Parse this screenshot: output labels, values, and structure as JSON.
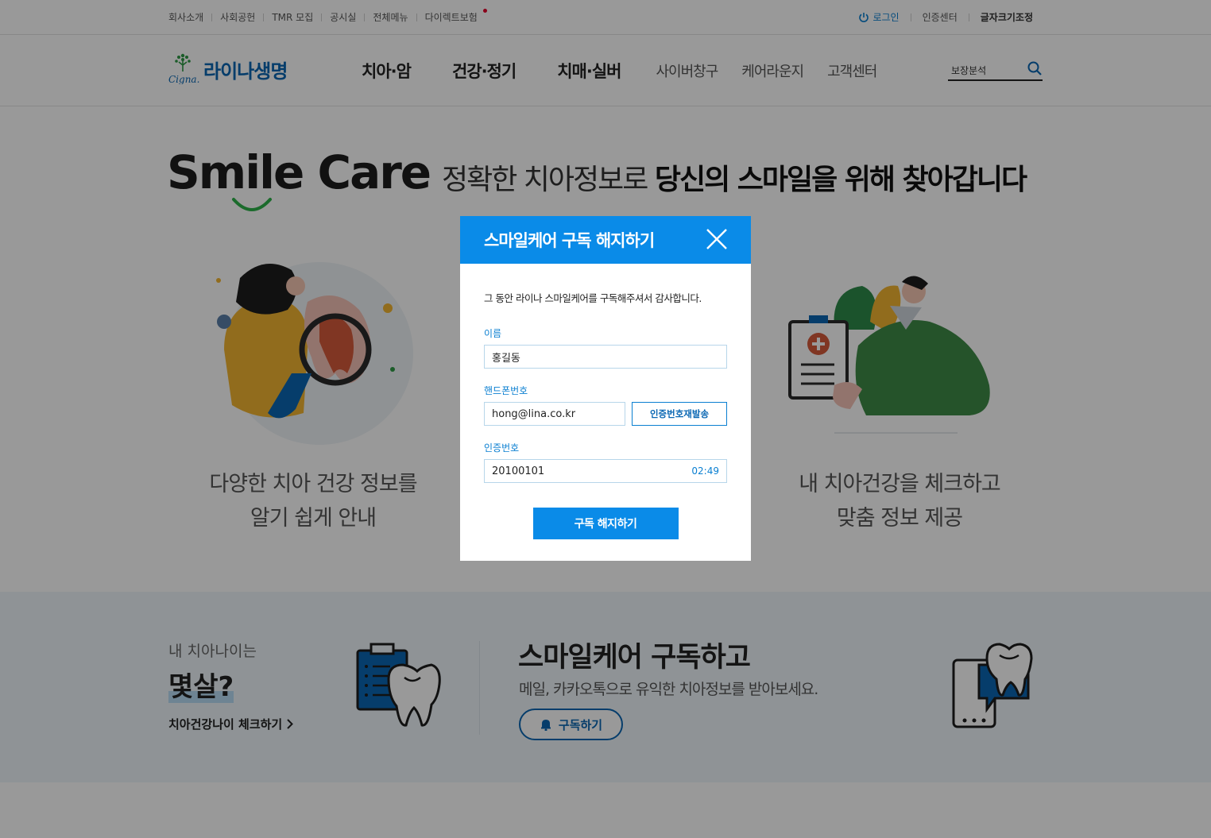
{
  "utility": {
    "left_links": [
      "회사소개",
      "사회공헌",
      "TMR 모집",
      "공시실",
      "전체메뉴",
      "다이렉트보험"
    ],
    "login": "로그인",
    "cert_center": "인증센터",
    "font_adjust": "글자크기조정"
  },
  "header": {
    "logo_brand": "Cigna.",
    "logo_text": "라이나생명",
    "nav_major": [
      "치아·암",
      "건강·정기",
      "치매·실버"
    ],
    "nav_minor": [
      "사이버창구",
      "케어라운지",
      "고객센터"
    ],
    "search_value": "보장분석"
  },
  "hero": {
    "brand": "Smile Care",
    "tagline_plain": "정확한 치아정보로 ",
    "tagline_bold": "당신의 스마일을 위해 찾아갑니다",
    "feature_left_line1": "다양한 치아 건강 정보를",
    "feature_left_line2": "알기 쉽게 안내",
    "feature_right_line1": "내 치아건강을 체크하고",
    "feature_right_line2": "맞춤 정보 제공"
  },
  "band": {
    "age_label": "내 치아나이는",
    "age_question": "몇살?",
    "age_link": "치아건강나이 체크하기",
    "sub_title": "스마일케어 구독하고",
    "sub_desc": "메일, 카카오톡으로 유익한 치아정보를 받아보세요.",
    "sub_button": "구독하기"
  },
  "modal": {
    "title": "스마일케어 구독 해지하기",
    "thanks": "그 동안 라이나 스마일케어를 구독해주셔서 감사합니다.",
    "name_label": "이름",
    "name_value": "홍길동",
    "phone_label": "핸드폰번호",
    "phone_value": "hong@lina.co.kr",
    "resend_button": "인증번호재발송",
    "code_label": "인증번호",
    "code_value": "20100101",
    "timer": "02:49",
    "submit_button": "구독 해지하기"
  },
  "colors": {
    "primary": "#0a8be8",
    "brand_blue": "#0a67b3",
    "dim": "rgba(0,0,0,0.40)"
  }
}
